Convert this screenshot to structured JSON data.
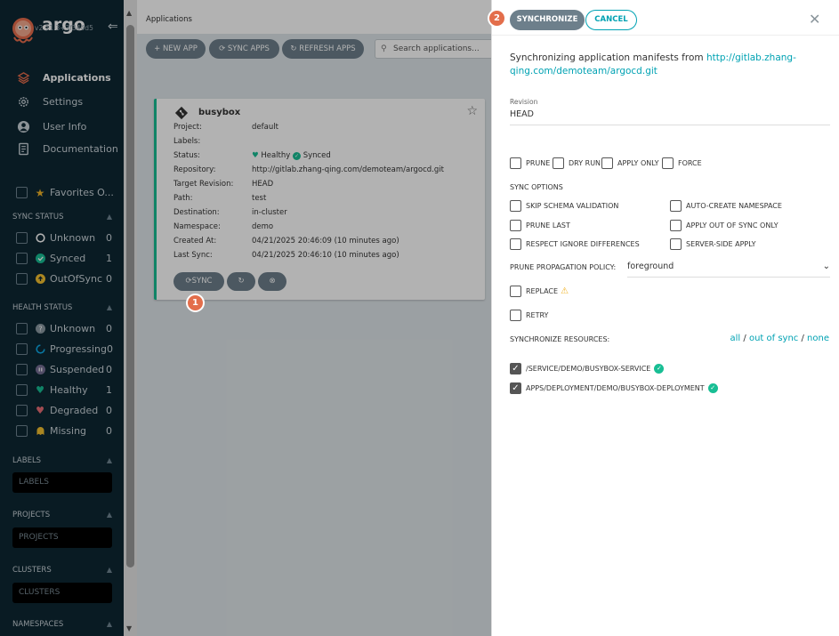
{
  "sidebar": {
    "logo_text": "argo",
    "version": "v2.11.3+3f344d5",
    "nav": [
      {
        "label": "Applications",
        "icon": "layers-icon"
      },
      {
        "label": "Settings",
        "icon": "gear-icon"
      },
      {
        "label": "User Info",
        "icon": "user-icon"
      },
      {
        "label": "Documentation",
        "icon": "book-icon"
      }
    ],
    "favorites_label": "Favorites O...",
    "sync_status": {
      "title": "SYNC STATUS",
      "items": [
        {
          "label": "Unknown",
          "count": "0"
        },
        {
          "label": "Synced",
          "count": "1"
        },
        {
          "label": "OutOfSync",
          "count": "0"
        }
      ]
    },
    "health_status": {
      "title": "HEALTH STATUS",
      "items": [
        {
          "label": "Unknown",
          "count": "0"
        },
        {
          "label": "Progressing",
          "count": "0"
        },
        {
          "label": "Suspended",
          "count": "0"
        },
        {
          "label": "Healthy",
          "count": "1"
        },
        {
          "label": "Degraded",
          "count": "0"
        },
        {
          "label": "Missing",
          "count": "0"
        }
      ]
    },
    "labels": {
      "title": "LABELS",
      "placeholder": "LABELS"
    },
    "projects": {
      "title": "PROJECTS",
      "placeholder": "PROJECTS"
    },
    "clusters": {
      "title": "CLUSTERS",
      "placeholder": "CLUSTERS"
    },
    "namespaces": {
      "title": "NAMESPACES"
    }
  },
  "main": {
    "breadcrumb": "Applications",
    "toolbar": {
      "new_app": "+ NEW APP",
      "sync_apps": "SYNC APPS",
      "refresh_apps": "REFRESH APPS",
      "search_placeholder": "Search applications..."
    },
    "card": {
      "name": "busybox",
      "fields": [
        {
          "k": "Project:",
          "v": "default"
        },
        {
          "k": "Labels:",
          "v": ""
        },
        {
          "k": "Status:",
          "v": ""
        },
        {
          "k": "Repository:",
          "v": "http://gitlab.zhang-qing.com/demoteam/argocd.git"
        },
        {
          "k": "Target Revision:",
          "v": "HEAD"
        },
        {
          "k": "Path:",
          "v": "test"
        },
        {
          "k": "Destination:",
          "v": "in-cluster"
        },
        {
          "k": "Namespace:",
          "v": "demo"
        },
        {
          "k": "Created At:",
          "v": "04/21/2025 20:46:09  (10 minutes ago)"
        },
        {
          "k": "Last Sync:",
          "v": "04/21/2025 20:46:10  (10 minutes ago)"
        }
      ],
      "health": "Healthy",
      "sync": "Synced",
      "sync_btn": "SYNC"
    },
    "badge1": "1"
  },
  "panel": {
    "badge2": "2",
    "synchronize_btn": "SYNCHRONIZE",
    "cancel_btn": "CANCEL",
    "intro": "Synchronizing application manifests from",
    "repo_line1": "http://gitlab.zhang-",
    "repo_line2": "qing.com/demoteam/argocd.git",
    "revision_label": "Revision",
    "revision_value": "HEAD",
    "options": {
      "prune": "PRUNE",
      "dry_run": "DRY RUN",
      "apply_only": "APPLY ONLY",
      "force": "FORCE"
    },
    "sync_options_title": "SYNC OPTIONS",
    "sync_options": {
      "skip_schema": "SKIP SCHEMA VALIDATION",
      "auto_create_ns": "AUTO-CREATE NAMESPACE",
      "prune_last": "PRUNE LAST",
      "apply_oos": "APPLY OUT OF SYNC ONLY",
      "respect_ignore": "RESPECT IGNORE DIFFERENCES",
      "server_side": "SERVER-SIDE APPLY"
    },
    "prune_policy_label": "PRUNE PROPAGATION POLICY:",
    "prune_policy_value": "foreground",
    "replace": "REPLACE",
    "retry": "RETRY",
    "sync_resources_label": "SYNCHRONIZE RESOURCES:",
    "res_all": "all",
    "res_oos": "out of sync",
    "res_none": "none",
    "sep": "/",
    "resources": [
      "/SERVICE/DEMO/BUSYBOX-SERVICE",
      "APPS/DEPLOYMENT/DEMO/BUSYBOX-DEPLOYMENT"
    ]
  }
}
